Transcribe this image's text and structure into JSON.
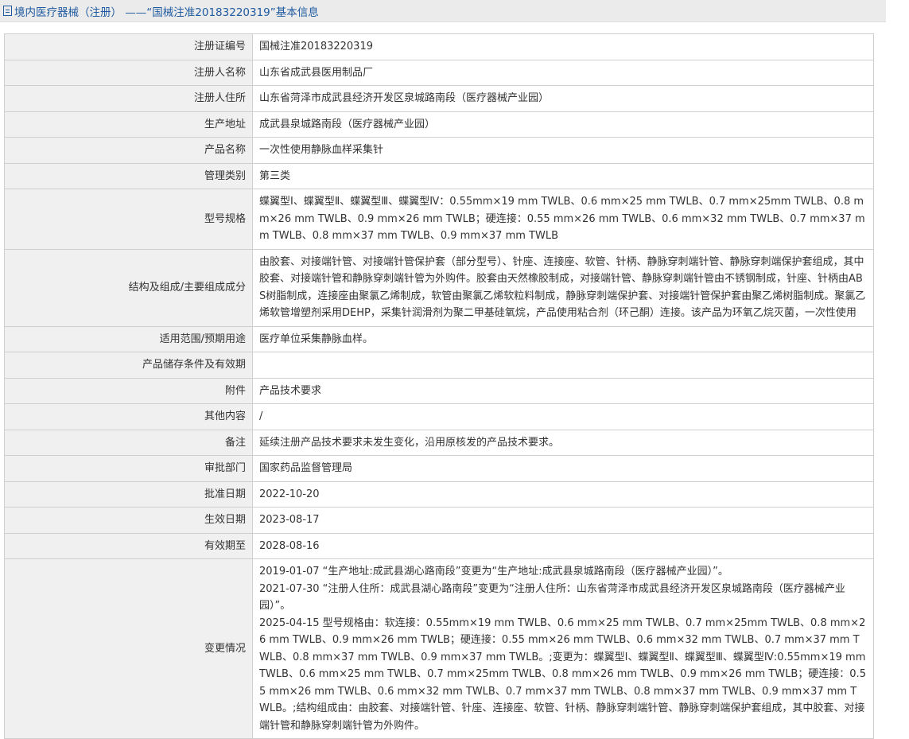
{
  "header": {
    "title": "境内医疗器械（注册） ——“国械注准20183220319”基本信息"
  },
  "fields": [
    {
      "label": "注册证编号",
      "value": "国械注准20183220319"
    },
    {
      "label": "注册人名称",
      "value": "山东省成武县医用制品厂"
    },
    {
      "label": "注册人住所",
      "value": "山东省菏泽市成武县经济开发区泉城路南段（医疗器械产业园）"
    },
    {
      "label": "生产地址",
      "value": "成武县泉城路南段（医疗器械产业园）"
    },
    {
      "label": "产品名称",
      "value": "一次性使用静脉血样采集针"
    },
    {
      "label": "管理类别",
      "value": "第三类"
    },
    {
      "label": "型号规格",
      "value": "蝶翼型Ⅰ、蝶翼型Ⅱ、蝶翼型Ⅲ、蝶翼型Ⅳ：0.55mm×19 mm TWLB、0.6 mm×25 mm TWLB、0.7 mm×25mm TWLB、0.8 mm×26 mm TWLB、0.9 mm×26 mm TWLB；硬连接：0.55 mm×26 mm TWLB、0.6 mm×32 mm TWLB、0.7 mm×37 mm TWLB、0.8 mm×37 mm TWLB、0.9 mm×37 mm TWLB"
    },
    {
      "label": "结构及组成/主要组成成分",
      "value": "由胶套、对接端针管、对接端针管保护套（部分型号）、针座、连接座、软管、针柄、静脉穿刺端针管、静脉穿刺端保护套组成，其中胶套、对接端针管和静脉穿刺端针管为外购件。胶套由天然橡胶制成，对接端针管、静脉穿刺端针管由不锈钢制成，针座、针柄由ABS树脂制成，连接座由聚氯乙烯制成，软管由聚氯乙烯软粒料制成，静脉穿刺端保护套、对接端针管保护套由聚乙烯树脂制成。聚氯乙烯软管增塑剂采用DEHP，采集针润滑剂为聚二甲基硅氧烷，产品使用粘合剂（环己酮）连接。该产品为环氧乙烷灭菌，一次性使用"
    },
    {
      "label": "适用范围/预期用途",
      "value": "医疗单位采集静脉血样。"
    },
    {
      "label": "产品储存条件及有效期",
      "value": ""
    },
    {
      "label": "附件",
      "value": "产品技术要求"
    },
    {
      "label": "其他内容",
      "value": "/"
    },
    {
      "label": "备注",
      "value": "延续注册产品技术要求未发生变化，沿用原核发的产品技术要求。"
    },
    {
      "label": "审批部门",
      "value": "国家药品监督管理局"
    },
    {
      "label": "批准日期",
      "value": "2022-10-20"
    },
    {
      "label": "生效日期",
      "value": "2023-08-17"
    },
    {
      "label": "有效期至",
      "value": "2028-08-16"
    }
  ],
  "changes": {
    "label": "变更情况",
    "entries": [
      "2019-01-07 “生产地址:成武县湖心路南段”变更为“生产地址:成武县泉城路南段（医疗器械产业园）”。",
      "2021-07-30 “注册人住所：成武县湖心路南段”变更为“注册人住所：山东省菏泽市成武县经济开发区泉城路南段（医疗器械产业园）”。",
      "2025-04-15 型号规格由：软连接：0.55mm×19 mm TWLB、0.6 mm×25 mm TWLB、0.7 mm×25mm TWLB、0.8 mm×26 mm TWLB、0.9 mm×26 mm TWLB；硬连接：0.55 mm×26 mm TWLB、0.6 mm×32 mm TWLB、0.7 mm×37 mm TWLB、0.8 mm×37 mm TWLB、0.9 mm×37 mm TWLB。;变更为：蝶翼型Ⅰ、蝶翼型Ⅱ、蝶翼型Ⅲ、蝶翼型Ⅳ:0.55mm×19 mm TWLB、0.6 mm×25 mm TWLB、0.7 mm×25mm TWLB、0.8 mm×26 mm TWLB、0.9 mm×26 mm TWLB；硬连接：0.55 mm×26 mm TWLB、0.6 mm×32 mm TWLB、0.7 mm×37 mm TWLB、0.8 mm×37 mm TWLB、0.9 mm×37 mm TWLB。;结构组成由：由胶套、对接端针管、针座、连接座、软管、针柄、静脉穿刺端针管、静脉穿刺端保护套组成，其中胶套、对接端针管和静脉穿刺端针管为外购件。"
    ]
  }
}
